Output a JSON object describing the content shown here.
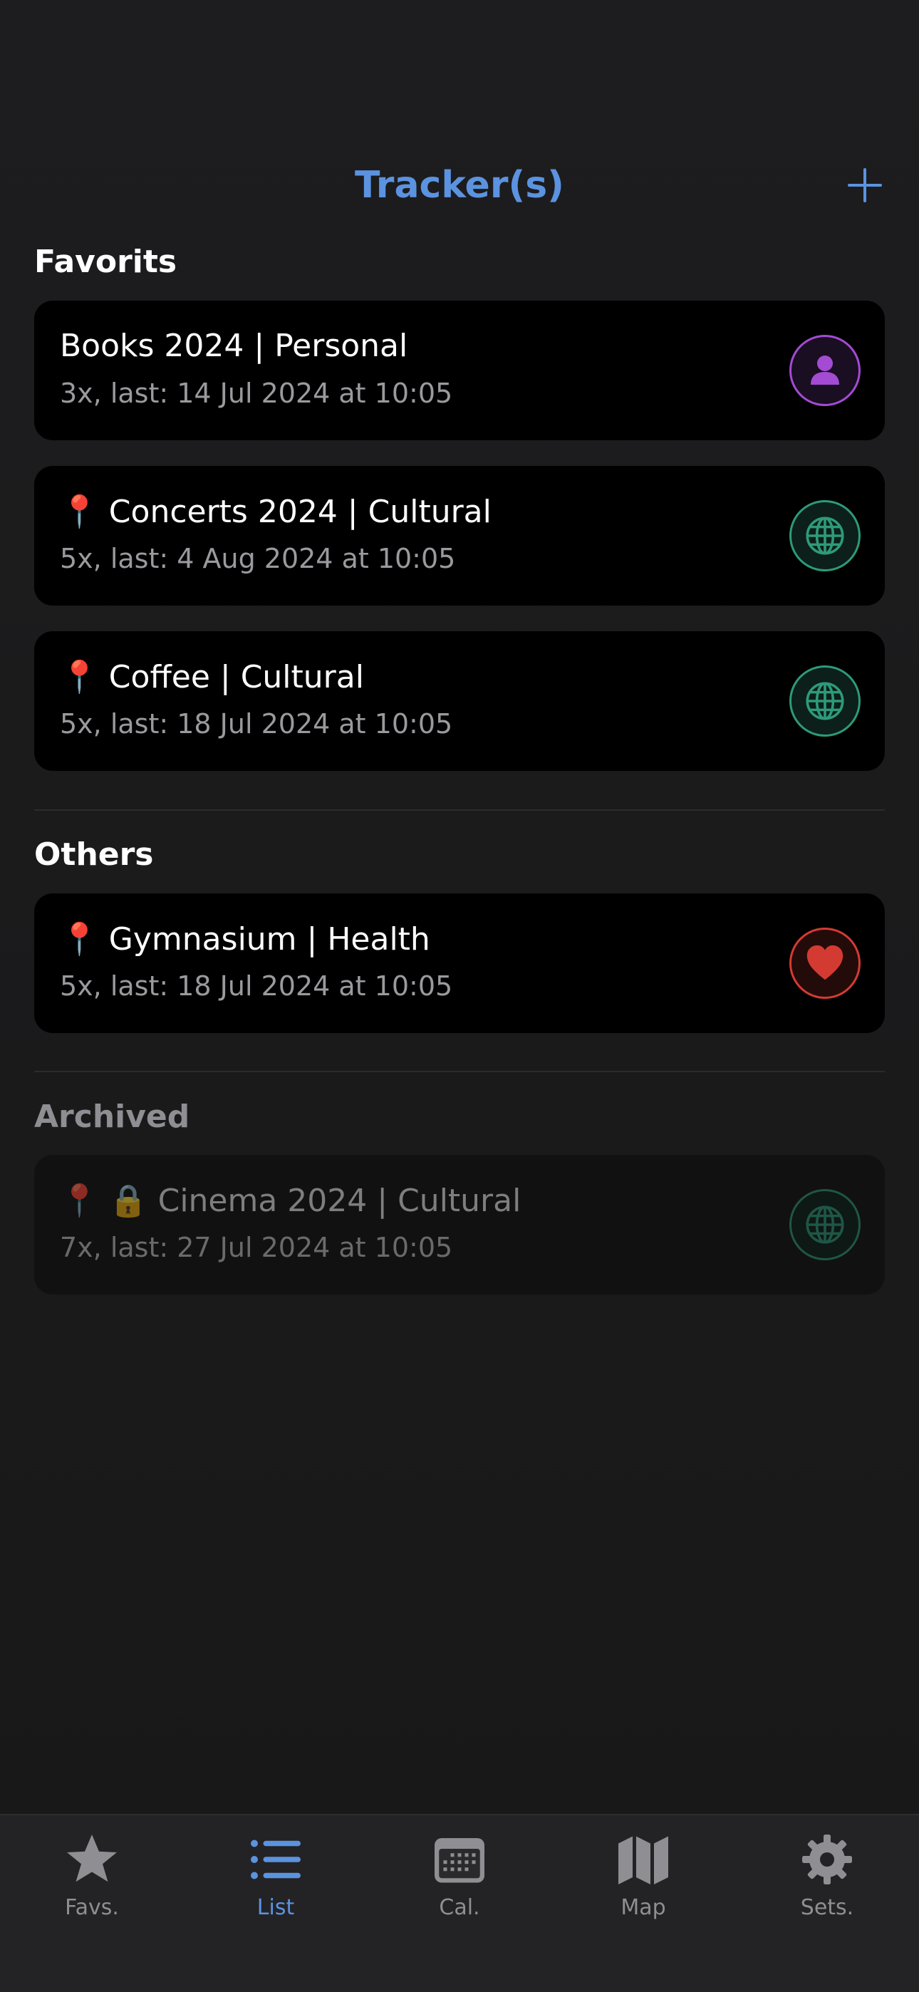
{
  "header": {
    "title": "Tracker(s)"
  },
  "sections": {
    "favorites": "Favorits",
    "others": "Others",
    "archived": "Archived"
  },
  "trackers": {
    "books": {
      "title": "Books 2024 | Personal",
      "subtitle": "3x, last: 14 Jul 2024 at 10:05",
      "pin": false,
      "locked": false,
      "category_icon": "person-icon"
    },
    "concerts": {
      "title": "Concerts 2024 | Cultural",
      "subtitle": "5x, last: 4 Aug 2024 at 10:05",
      "pin": true,
      "locked": false,
      "category_icon": "globe-icon"
    },
    "coffee": {
      "title": "Coffee | Cultural",
      "subtitle": "5x, last: 18 Jul 2024 at 10:05",
      "pin": true,
      "locked": false,
      "category_icon": "globe-icon"
    },
    "gymnasium": {
      "title": "Gymnasium | Health",
      "subtitle": "5x, last: 18 Jul 2024 at 10:05",
      "pin": true,
      "locked": false,
      "category_icon": "heart-icon"
    },
    "cinema": {
      "title": "Cinema 2024 | Cultural",
      "subtitle": "7x, last: 27 Jul 2024 at 10:05",
      "pin": true,
      "locked": true,
      "category_icon": "globe-icon"
    }
  },
  "glyphs": {
    "pin": "📍",
    "lock": "🔒"
  },
  "tabs": {
    "favs": "Favs.",
    "list": "List",
    "cal": "Cal.",
    "map": "Map",
    "sets": "Sets."
  },
  "colors": {
    "accent": "#5b93e0",
    "personal": "#a34bd3",
    "cultural": "#2e9a7a",
    "health": "#d33b32"
  },
  "active_tab": "list"
}
